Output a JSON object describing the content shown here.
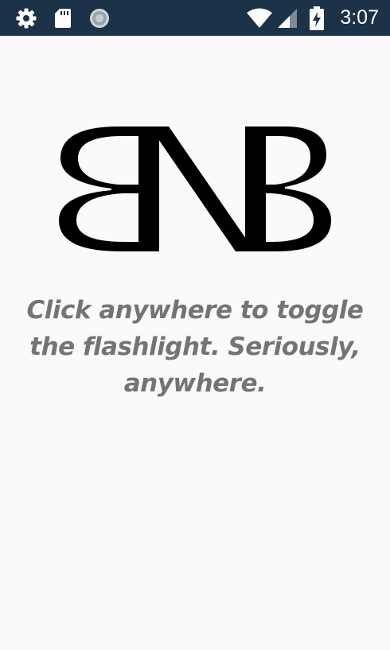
{
  "status_bar": {
    "time": "3:07",
    "icons": [
      "gear-icon",
      "sd-card-icon",
      "loading-icon",
      "wifi-icon",
      "signal-icon",
      "battery-charging-icon"
    ],
    "background_color": "#1b3248"
  },
  "app": {
    "logo_text": "BNB",
    "instruction": "Click anywhere to toggle the flashlight. Seriously, anywhere.",
    "background_color": "#fafafa",
    "text_color": "#747474"
  }
}
